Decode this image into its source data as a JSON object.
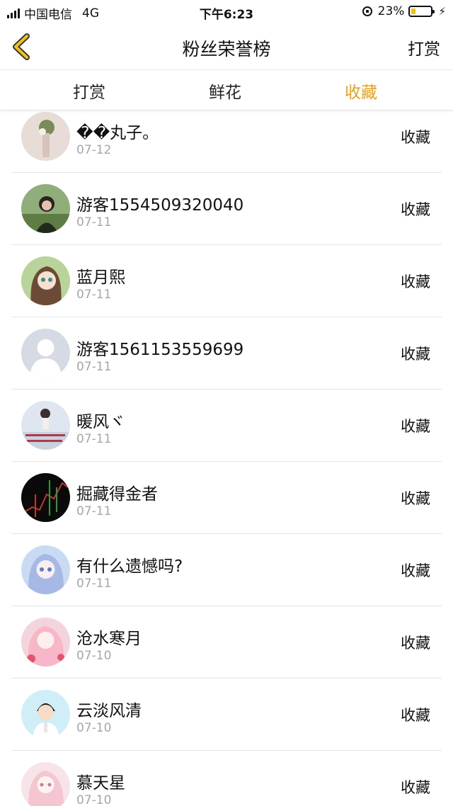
{
  "status_bar": {
    "carrier": "中国电信",
    "network": "4G",
    "time": "下午6:23",
    "battery_percent": "23%",
    "battery_level": 0.23
  },
  "header": {
    "title": "粉丝荣誉榜",
    "action": "打赏",
    "back_icon": "chevron-left-icon",
    "accent_color": "#e9a11b"
  },
  "tabs": [
    {
      "label": "打赏",
      "active": false
    },
    {
      "label": "鲜花",
      "active": false
    },
    {
      "label": "收藏",
      "active": true
    }
  ],
  "list": [
    {
      "name": "��丸子。",
      "date": "07-12",
      "tag": "收藏"
    },
    {
      "name": "游客1554509320040",
      "date": "07-11",
      "tag": "收藏"
    },
    {
      "name": "蓝月熙",
      "date": "07-11",
      "tag": "收藏"
    },
    {
      "name": "游客1561153559699",
      "date": "07-11",
      "tag": "收藏"
    },
    {
      "name": "暖风ヾ",
      "date": "07-11",
      "tag": "收藏"
    },
    {
      "name": "掘藏得金者",
      "date": "07-11",
      "tag": "收藏"
    },
    {
      "name": "有什么遗憾吗?",
      "date": "07-11",
      "tag": "收藏"
    },
    {
      "name": "沧水寒月",
      "date": "07-10",
      "tag": "收藏"
    },
    {
      "name": "云淡风清",
      "date": "07-10",
      "tag": "收藏"
    },
    {
      "name": "慕天星",
      "date": "07-10",
      "tag": "收藏"
    }
  ]
}
